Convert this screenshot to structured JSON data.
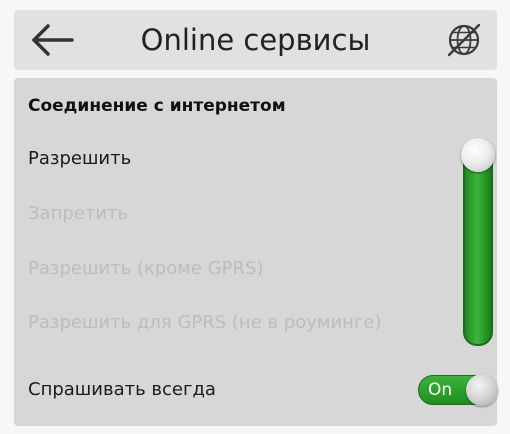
{
  "header": {
    "title": "Online сервисы",
    "back_icon": "arrow-left-icon",
    "right_icon": "globe-off-icon"
  },
  "connection": {
    "section_title": "Соединение с интернетом",
    "options": [
      {
        "label": "Разрешить",
        "selected": true
      },
      {
        "label": "Запретить",
        "selected": false
      },
      {
        "label": "Разрешить (кроме GPRS)",
        "selected": false
      },
      {
        "label": "Разрешить для GPRS (не в роуминге)",
        "selected": false
      }
    ],
    "selected_index": 0
  },
  "ask_always": {
    "label": "Спрашивать всегда",
    "state_text": "On",
    "enabled": true
  },
  "colors": {
    "header_bg": "#e1e1e1",
    "panel_bg": "#d7d7d7",
    "accent_green": "#2aa12a",
    "disabled_text": "#bdbdbd"
  }
}
